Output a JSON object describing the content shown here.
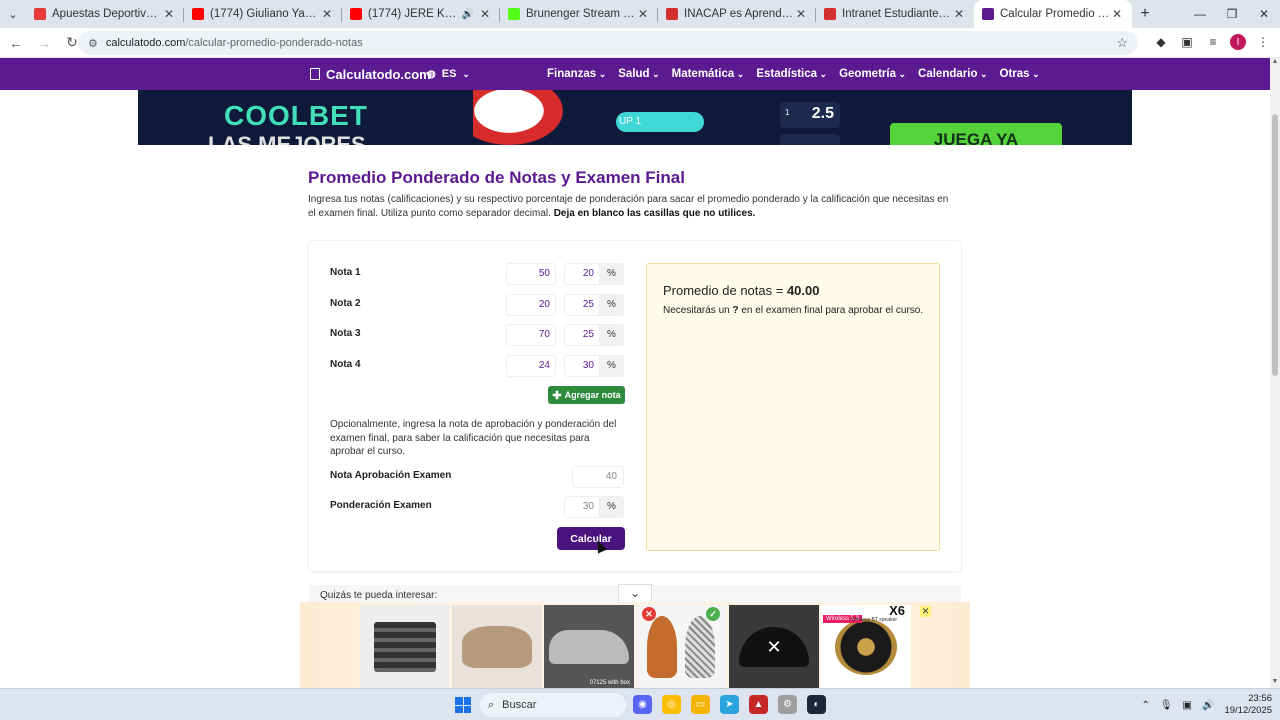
{
  "browser": {
    "tabs": [
      {
        "title": "Apuestas Deportivas - Apuesta",
        "color": "#e53935",
        "active": false
      },
      {
        "title": "(1774) Giuliano Yankees ft Tuno",
        "color": "#ff0000",
        "active": false
      },
      {
        "title": "(1774) JERE KLEIN & BAYR",
        "color": "#ff0000",
        "active": false,
        "audio": true
      },
      {
        "title": "Brunenger Stream - Watch Live",
        "color": "#53fc18",
        "active": false
      },
      {
        "title": "INACAP es Aprender Haciendo",
        "color": "#d32f2f",
        "active": false
      },
      {
        "title": "Intranet Estudiante | INACAP",
        "color": "#d32f2f",
        "active": false
      },
      {
        "title": "Calcular Promedio Ponderado",
        "color": "#5b1a8f",
        "active": true
      }
    ],
    "url_host": "calculatodo.com",
    "url_path": "/calcular-promedio-ponderado-notas"
  },
  "site": {
    "brand": "Calculatodo.com",
    "lang": "ES",
    "menu": [
      "Finanzas",
      "Salud",
      "Matemática",
      "Estadística",
      "Geometría",
      "Calendario",
      "Otras"
    ],
    "accent": "#5b1a8f"
  },
  "ad_top": {
    "brand": "COOLBET",
    "headline": "LAS MEJORES",
    "up_label": "UP 1",
    "odds_index": "1",
    "odds_value": "2.5",
    "cta": "JUEGA YA"
  },
  "main": {
    "title": "Promedio Ponderado de Notas y Examen Final",
    "intro": "Ingresa tus notas (calificaciones) y su respectivo porcentaje de ponderación para sacar el promedio ponderado y la calificación que necesitas en el examen final. Utiliza punto como separador decimal.",
    "intro_bold": "Deja en blanco las casillas que no utilices.",
    "grades": [
      {
        "label": "Nota 1",
        "grade": "50",
        "weight": "20"
      },
      {
        "label": "Nota 2",
        "grade": "20",
        "weight": "25"
      },
      {
        "label": "Nota 3",
        "grade": "70",
        "weight": "25"
      },
      {
        "label": "Nota 4",
        "grade": "24",
        "weight": "30"
      }
    ],
    "percent_sign": "%",
    "add_button": "Agregar nota",
    "optional_text": "Opcionalmente, ingresa la nota de aprobación y ponderación del examen final, para saber la calificación que necesitas para aprobar el curso.",
    "exam_pass_label": "Nota Aprobación Examen",
    "exam_pass_placeholder": "40",
    "exam_weight_label": "Ponderación Examen",
    "exam_weight_placeholder": "30",
    "calc_button": "Calcular",
    "result_prefix": "Promedio de notas = ",
    "result_value": "40.00",
    "need_text": "Necesitarás un ",
    "need_value": "?",
    "need_suffix": " en el examen final para aprobar el curso.",
    "maybe_text": "Quizás te pueda interesar:"
  },
  "ad_bottom": {
    "car_caption": "07125 with box",
    "speaker_tag": "Wireless 5.3",
    "speaker_sub": "Wireless BT speaker",
    "speaker_model": "X6"
  },
  "taskbar": {
    "search_label": "Buscar",
    "time": "23:56",
    "date": "19/12/2025"
  }
}
